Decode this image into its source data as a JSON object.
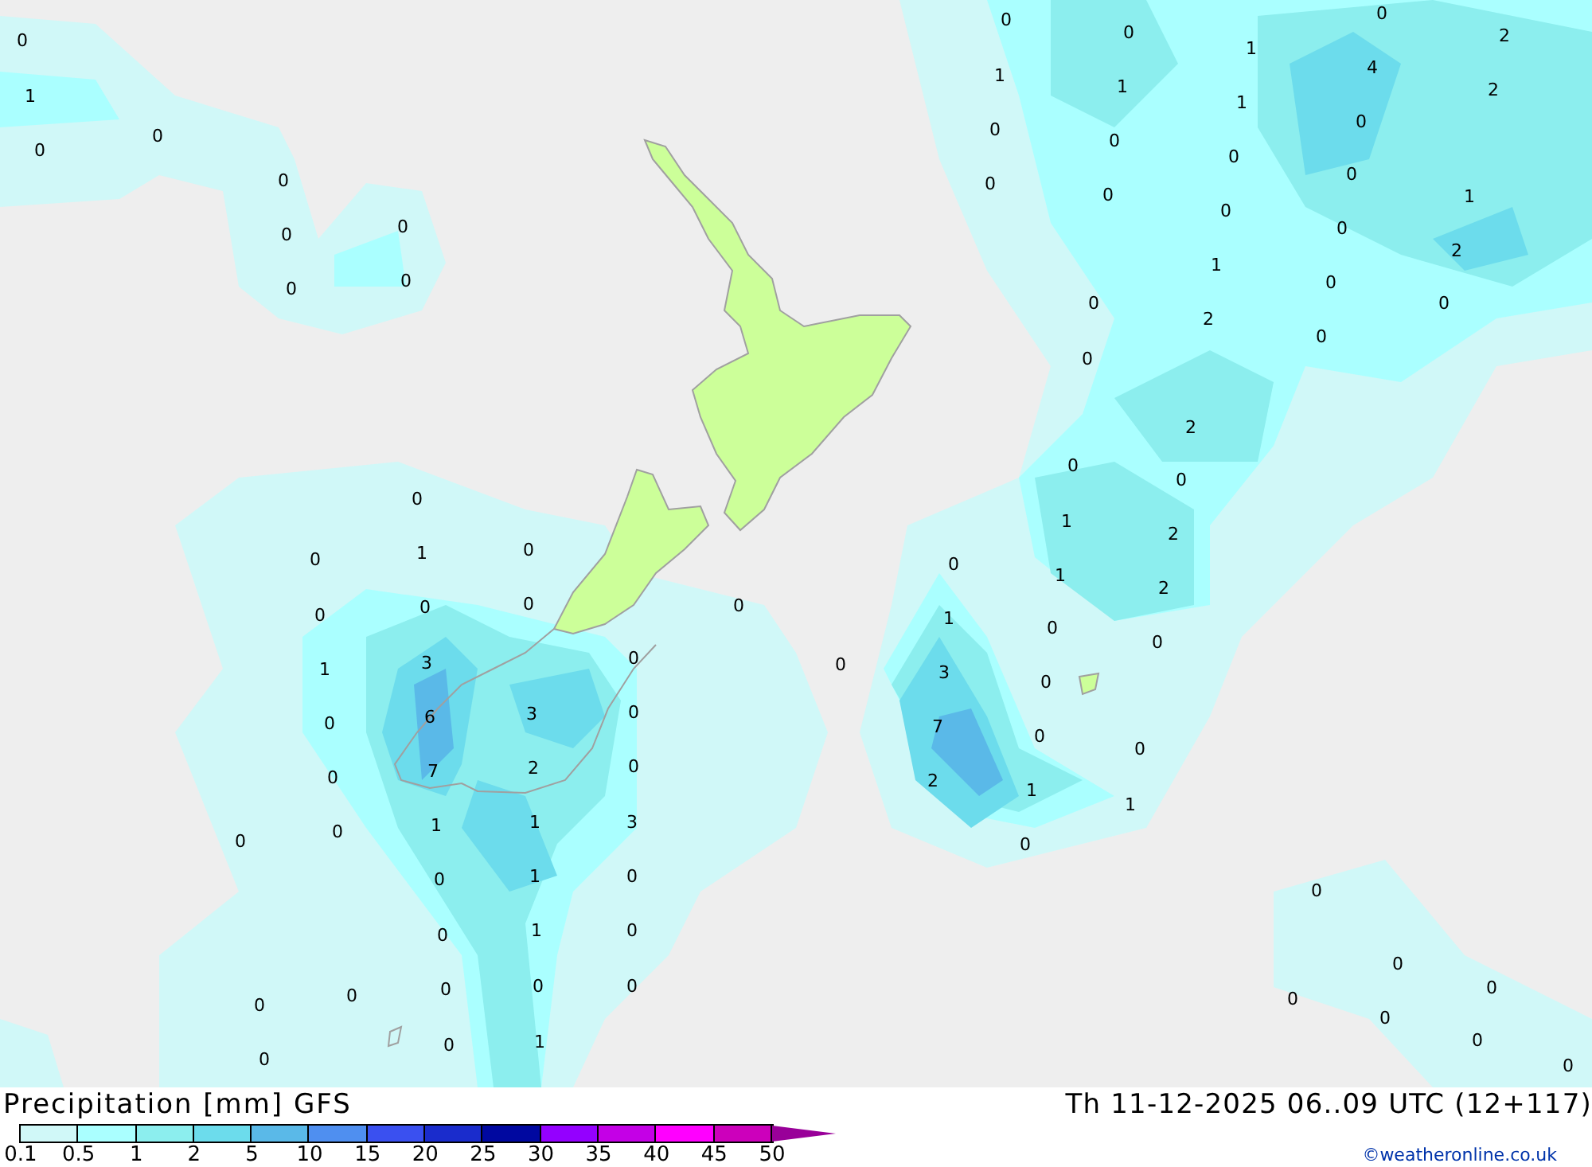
{
  "map": {
    "value_labels": [
      "0",
      "1",
      "0",
      "0",
      "0",
      "0",
      "0",
      "0",
      "0",
      "0",
      "0",
      "0",
      "1",
      "0",
      "2",
      "1",
      "1",
      "4",
      "1",
      "2",
      "0",
      "0",
      "0",
      "0",
      "0",
      "0",
      "0",
      "1",
      "0",
      "0",
      "2",
      "1",
      "0",
      "0",
      "0",
      "2",
      "0",
      "0",
      "2",
      "0",
      "0",
      "1",
      "2",
      "0",
      "1",
      "0",
      "0",
      "0",
      "0",
      "0",
      "1",
      "3",
      "0",
      "0",
      "6",
      "3",
      "0",
      "0",
      "7",
      "2",
      "0",
      "0",
      "0",
      "1",
      "1",
      "3",
      "0",
      "1",
      "0",
      "0",
      "1",
      "0",
      "0",
      "0",
      "0",
      "0",
      "0",
      "0",
      "0",
      "1",
      "0",
      "1",
      "2",
      "1",
      "0",
      "0",
      "0",
      "3",
      "0",
      "7",
      "0",
      "0",
      "2",
      "1",
      "1",
      "0",
      "0",
      "0",
      "0",
      "0",
      "0",
      "0",
      "0"
    ]
  },
  "footer": {
    "title": "Precipitation [mm] GFS",
    "valid_time": "Th 11-12-2025 06..09 UTC (12+117)",
    "copyright": "©weatheronline.co.uk"
  },
  "legend": {
    "bins": [
      {
        "color": "#d0f8f8"
      },
      {
        "color": "#aaffff"
      },
      {
        "color": "#8ceeee"
      },
      {
        "color": "#6cdcec"
      },
      {
        "color": "#5ab9e8"
      },
      {
        "color": "#4f8ff0"
      },
      {
        "color": "#3a50f0"
      },
      {
        "color": "#1a2ccc"
      },
      {
        "color": "#0008a0"
      },
      {
        "color": "#9400ff"
      },
      {
        "color": "#c400e6"
      },
      {
        "color": "#ff00ff"
      },
      {
        "color": "#cc00bb"
      }
    ],
    "ticks": [
      "0.1",
      "0.5",
      "1",
      "2",
      "5",
      "10",
      "15",
      "20",
      "25",
      "30",
      "35",
      "40",
      "45",
      "50"
    ]
  }
}
